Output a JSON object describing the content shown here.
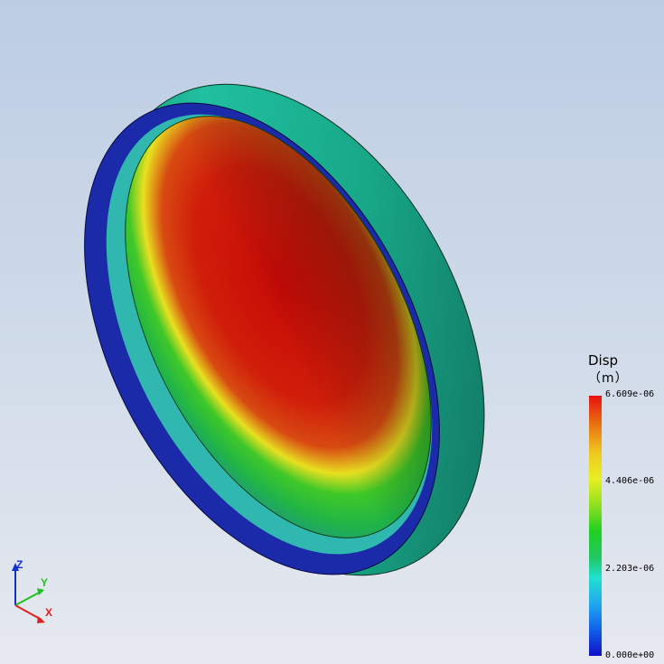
{
  "legend": {
    "title": "Disp",
    "unit": "（m）",
    "max_label": "6.609e-06",
    "mid_high_label": "4.406e-06",
    "mid_low_label": "2.203e-06",
    "min_label": "0.000e+00",
    "colors": [
      "#e81010",
      "#f0c820",
      "#20d020",
      "#20e0d0",
      "#1010c8"
    ]
  },
  "triad": {
    "x_label": "X",
    "y_label": "Y",
    "z_label": "Z",
    "x_color": "#e02020",
    "y_color": "#20c020",
    "z_color": "#1030d0"
  }
}
